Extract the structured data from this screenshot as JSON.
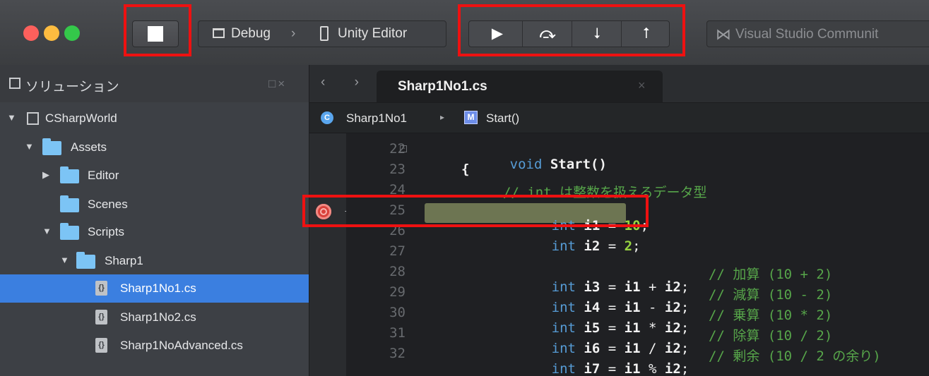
{
  "toolbar": {
    "window_controls": [
      "close",
      "minimize",
      "zoom"
    ],
    "stop_icon": "stop-icon",
    "configuration": {
      "name": "Debug",
      "separator": "›",
      "target": "Unity Editor"
    },
    "debug_buttons": [
      {
        "name": "continue",
        "glyph": "▶"
      },
      {
        "name": "step-over",
        "glyph": "⤼"
      },
      {
        "name": "step-into",
        "glyph": "⭣"
      },
      {
        "name": "step-out",
        "glyph": "⭡"
      }
    ],
    "status_label": "Visual Studio Communit"
  },
  "sidebar": {
    "title": "ソリューション",
    "controls": "□×",
    "tree": [
      {
        "label": "CSharpWorld",
        "kind": "solution",
        "expanded": true
      },
      {
        "label": "Assets",
        "kind": "folder",
        "expanded": true
      },
      {
        "label": "Editor",
        "kind": "folder",
        "expanded": false
      },
      {
        "label": "Scenes",
        "kind": "folder"
      },
      {
        "label": "Scripts",
        "kind": "folder",
        "expanded": true
      },
      {
        "label": "Sharp1",
        "kind": "folder",
        "expanded": true
      },
      {
        "label": "Sharp1No1.cs",
        "kind": "file",
        "selected": true
      },
      {
        "label": "Sharp1No2.cs",
        "kind": "file"
      },
      {
        "label": "Sharp1NoAdvanced.cs",
        "kind": "file"
      }
    ]
  },
  "editor": {
    "nav_arrows": "‹ ›",
    "tab": {
      "label": "Sharp1No1.cs",
      "close": "×"
    },
    "path": {
      "class_name": "Sharp1No1",
      "separator": "▸",
      "member_icon": "M",
      "member_name": "Start()"
    },
    "current_line": 25,
    "lines": [
      {
        "no": "22",
        "code": "void Start()"
      },
      {
        "no": "23",
        "code": "{"
      },
      {
        "no": "24",
        "code": "// int は整数を扱えるデータ型"
      },
      {
        "no": "25",
        "code": "int i1 = 10;"
      },
      {
        "no": "26",
        "code": "int i2 = 2;"
      },
      {
        "no": "27",
        "code": ""
      },
      {
        "no": "28",
        "code": "int i3 = i1 + i2;",
        "comment": "// 加算 (10 + 2)"
      },
      {
        "no": "29",
        "code": "int i4 = i1 - i2;",
        "comment": "// 減算 (10 - 2)"
      },
      {
        "no": "30",
        "code": "int i5 = i1 * i2;",
        "comment": "// 乗算 (10 * 2)"
      },
      {
        "no": "31",
        "code": "int i6 = i1 / i2;",
        "comment": "// 除算 (10 / 2)"
      },
      {
        "no": "32",
        "code": "int i7 = i1 % i2;",
        "comment": "// 剰余 (10 / 2 の余り)"
      }
    ]
  },
  "colors": {
    "annotation_red": "#ee1111",
    "selection_blue": "#3b7fe0",
    "folder_blue": "#7cc4f5",
    "keyword_blue": "#569cd6",
    "number_green": "#97d441",
    "comment_green": "#57a64a",
    "breakpoint_red": "#d9413b",
    "execution_highlight": "#6d7552"
  }
}
